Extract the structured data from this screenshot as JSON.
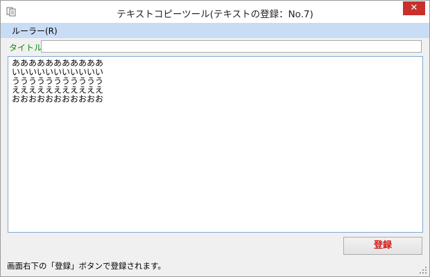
{
  "window": {
    "title": "テキストコピーツール(テキストの登録：No.7)",
    "close_glyph": "✕"
  },
  "menu": {
    "items": [
      {
        "label": "ルーラー(R)"
      }
    ]
  },
  "form": {
    "title_label": "タイトル",
    "title_value": "",
    "body_text": "あああああああああああ\nいいいいいいいいいいい\nううううううううううう\nえええええええええええ\nおおおおおおおおおおお"
  },
  "actions": {
    "register_label": "登録"
  },
  "status": {
    "text": "画面右下の「登録」ボタンで登録されます。"
  },
  "colors": {
    "menubar": "#c9dcf5",
    "close_button": "#c7302b",
    "label_green": "#0a8a0a",
    "register_red": "#d21a1a"
  }
}
